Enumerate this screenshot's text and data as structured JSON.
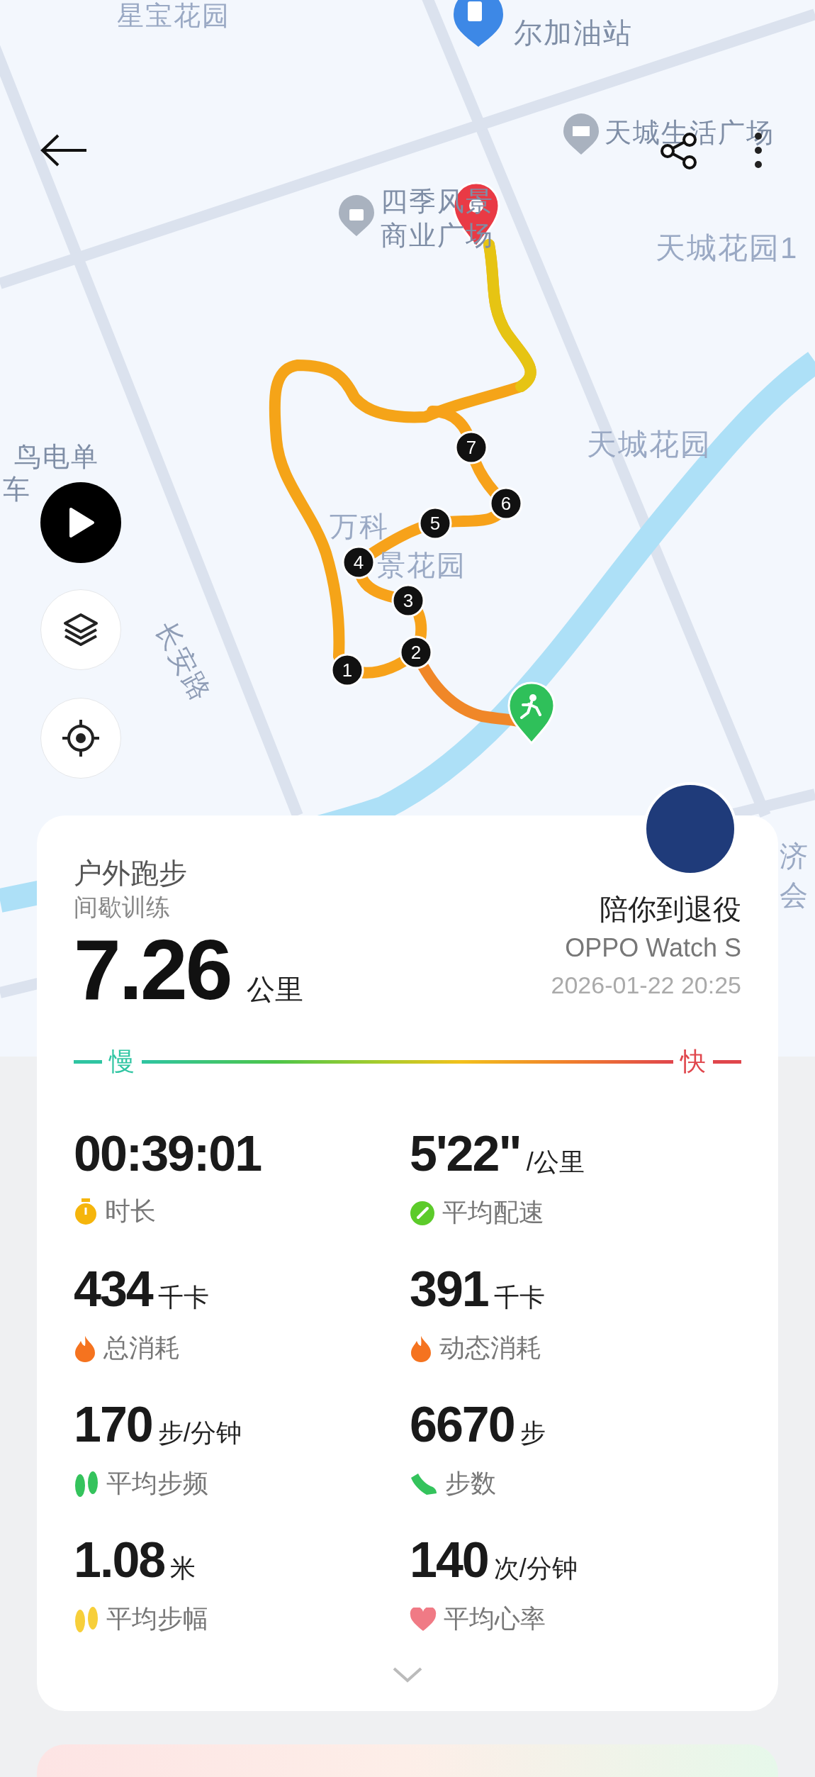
{
  "map": {
    "labels": [
      {
        "text": "星宝花园",
        "kind": "area"
      },
      {
        "text": "尔加油站",
        "kind": "poi"
      },
      {
        "text": "天城生活广场",
        "kind": "poi"
      },
      {
        "text": "四季风景",
        "kind": "poi"
      },
      {
        "text": "商业广场",
        "kind": "poi"
      },
      {
        "text": "天城花园1",
        "kind": "area"
      },
      {
        "text": "天城花园",
        "kind": "area"
      },
      {
        "text": "鸟电单",
        "kind": "poi"
      },
      {
        "text": "车",
        "kind": "poi"
      },
      {
        "text": "万科",
        "kind": "area"
      },
      {
        "text": "景花园",
        "kind": "area"
      },
      {
        "text": "长安路",
        "kind": "road"
      },
      {
        "text": "济",
        "kind": "area"
      },
      {
        "text": "会",
        "kind": "area"
      }
    ],
    "laps": [
      "1",
      "2",
      "3",
      "4",
      "5",
      "6",
      "7"
    ]
  },
  "card": {
    "sport": "户外跑步",
    "mode": "间歇训练",
    "distance": "7.26",
    "distance_unit": "公里",
    "user": "陪你到退役",
    "device": "OPPO Watch S",
    "datetime": "2026-01-22 20:25",
    "pace_legend": {
      "slow": "慢",
      "fast": "快"
    },
    "stats": [
      {
        "value": "00:39:01",
        "label": "时长",
        "kind": "stopwatch"
      },
      {
        "value": "5'22\"",
        "unit": "/公里",
        "label": "平均配速",
        "kind": "gauge"
      },
      {
        "value": "434",
        "unit": "千卡",
        "label": "总消耗",
        "kind": "flame"
      },
      {
        "value": "391",
        "unit": "千卡",
        "label": "动态消耗",
        "kind": "flame"
      },
      {
        "value": "170",
        "unit": "步/分钟",
        "label": "平均步频",
        "kind": "footprints"
      },
      {
        "value": "6670",
        "unit": "步",
        "label": "步数",
        "kind": "shoe"
      },
      {
        "value": "1.08",
        "unit": "米",
        "label": "平均步幅",
        "kind": "footprints-pale"
      },
      {
        "value": "140",
        "unit": "次/分钟",
        "label": "平均心率",
        "kind": "heart"
      }
    ]
  }
}
